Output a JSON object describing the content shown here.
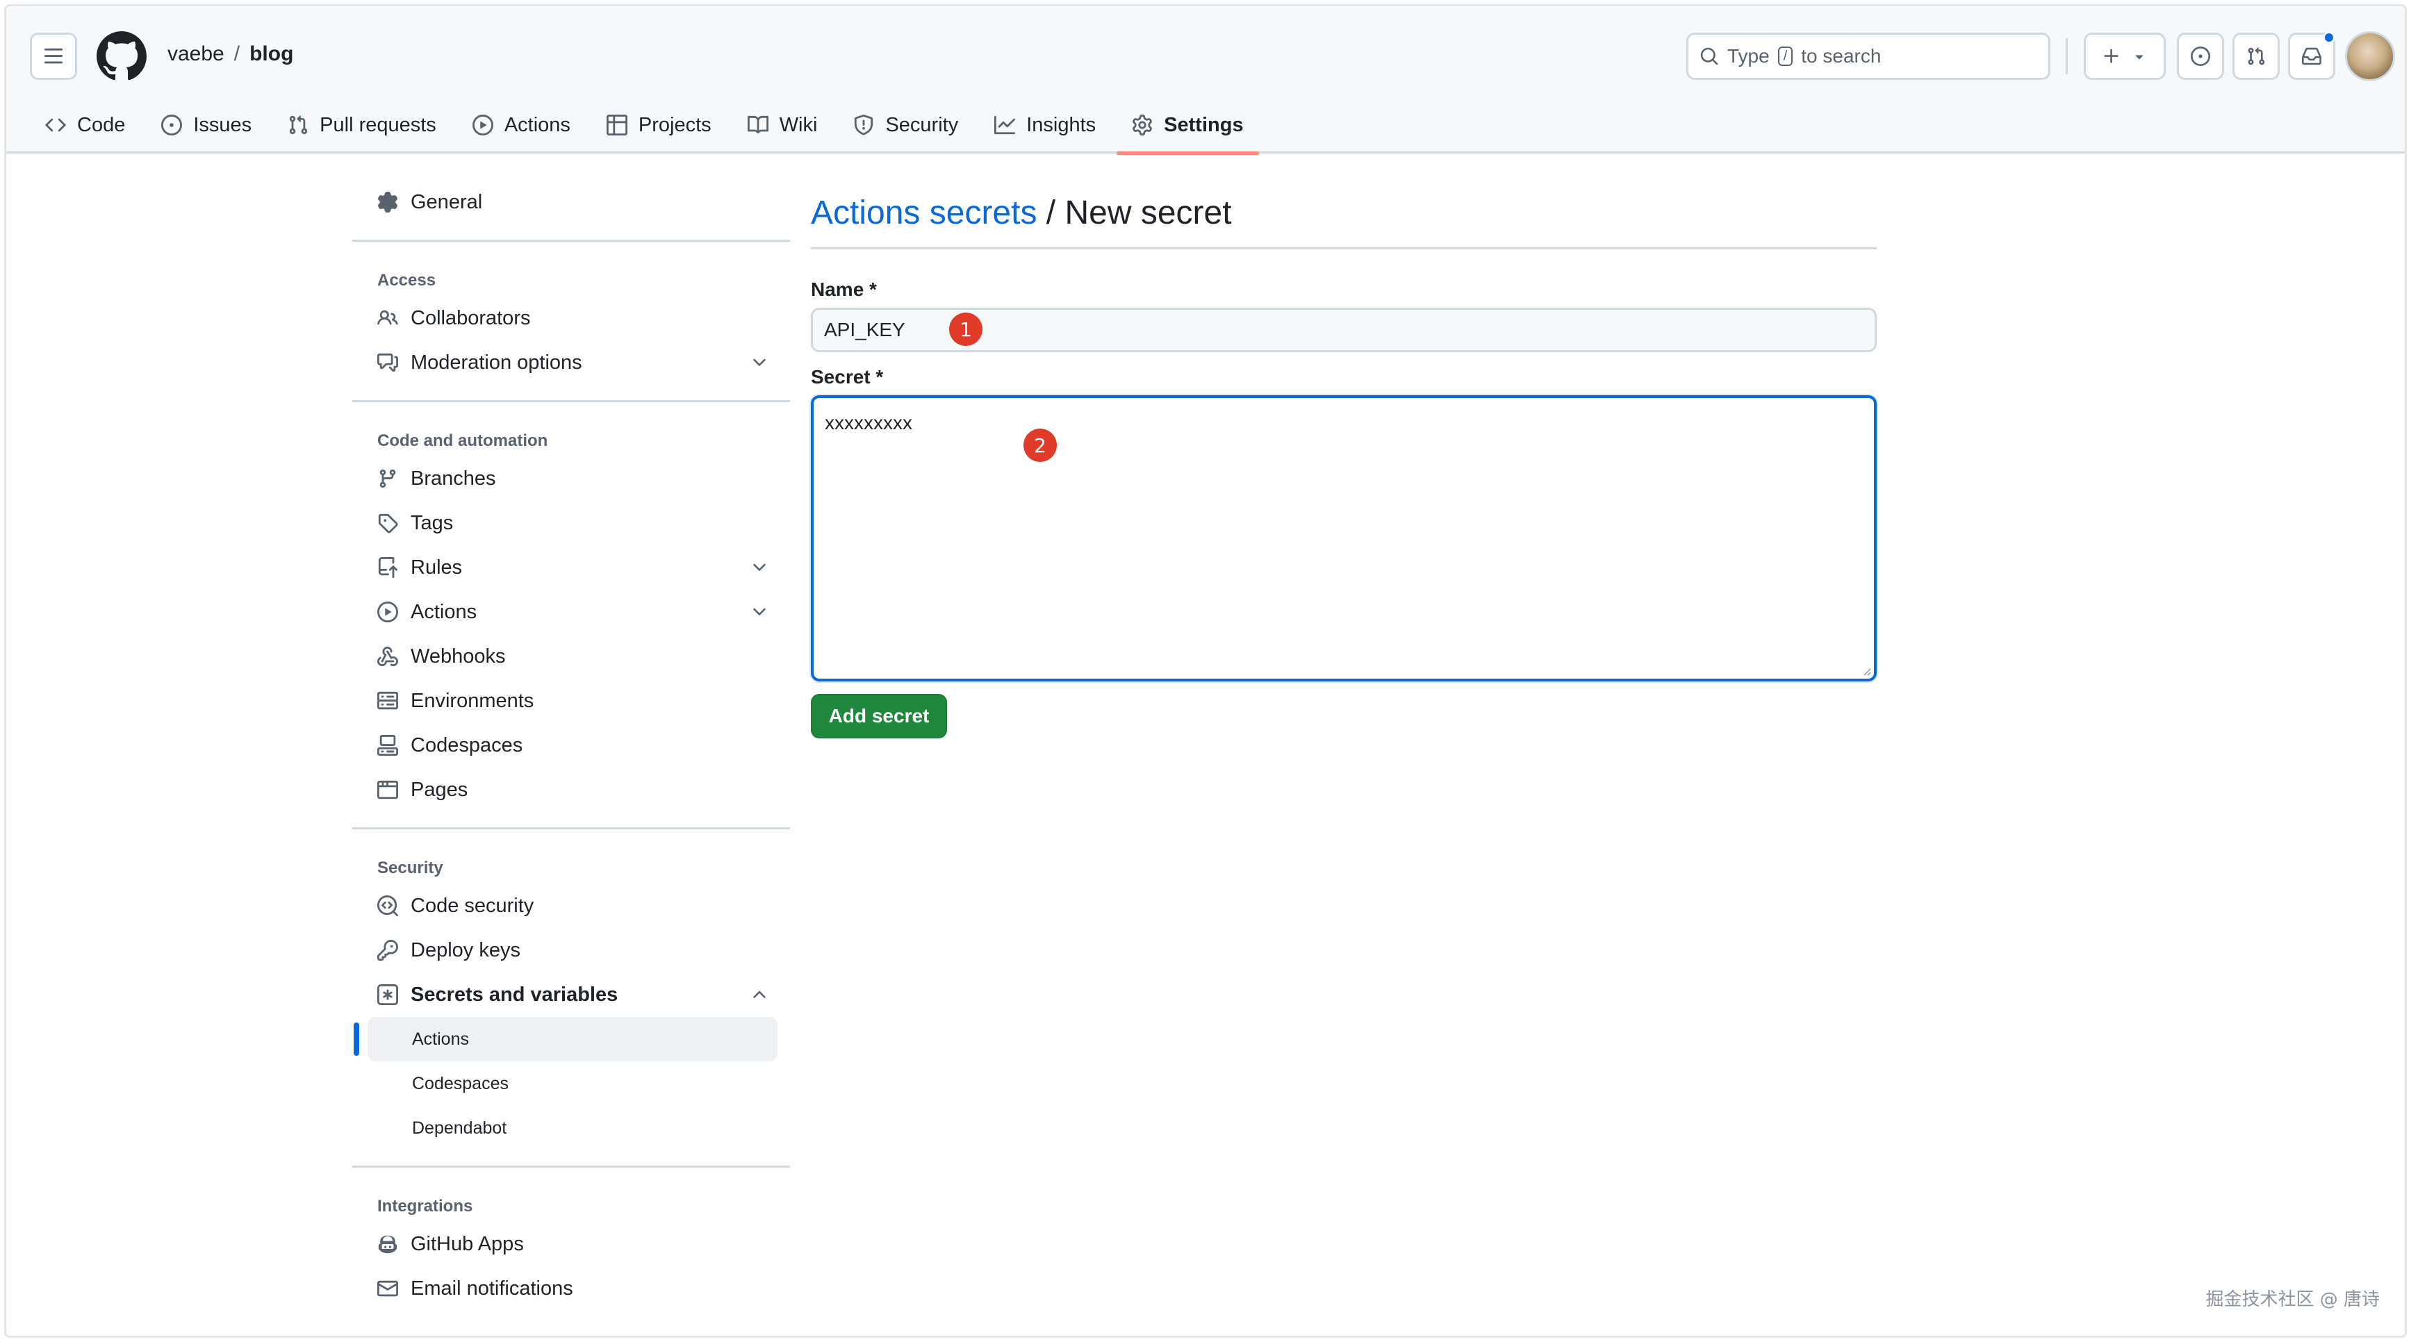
{
  "header": {
    "owner": "vaebe",
    "separator": "/",
    "repo": "blog",
    "search": {
      "prefix": "Type",
      "key": "/",
      "suffix": "to search"
    }
  },
  "tabs": [
    {
      "label": "Code",
      "icon": "code-icon"
    },
    {
      "label": "Issues",
      "icon": "issue-icon"
    },
    {
      "label": "Pull requests",
      "icon": "pull-request-icon"
    },
    {
      "label": "Actions",
      "icon": "play-icon"
    },
    {
      "label": "Projects",
      "icon": "table-icon"
    },
    {
      "label": "Wiki",
      "icon": "book-icon"
    },
    {
      "label": "Security",
      "icon": "shield-icon"
    },
    {
      "label": "Insights",
      "icon": "graph-icon"
    },
    {
      "label": "Settings",
      "icon": "gear-icon",
      "active": true
    }
  ],
  "sidebar": {
    "general": "General",
    "access_heading": "Access",
    "collaborators": "Collaborators",
    "moderation": "Moderation options",
    "code_heading": "Code and automation",
    "branches": "Branches",
    "tags": "Tags",
    "rules": "Rules",
    "actions": "Actions",
    "webhooks": "Webhooks",
    "environments": "Environments",
    "codespaces": "Codespaces",
    "pages": "Pages",
    "security_heading": "Security",
    "code_security": "Code security",
    "deploy_keys": "Deploy keys",
    "secrets_vars": "Secrets and variables",
    "sub_actions": "Actions",
    "sub_codespaces": "Codespaces",
    "sub_dependabot": "Dependabot",
    "integrations_heading": "Integrations",
    "github_apps": "GitHub Apps",
    "email_notifications": "Email notifications"
  },
  "main": {
    "title_link": "Actions secrets",
    "title_rest": " / New secret",
    "name_label": "Name *",
    "name_value": "API_KEY",
    "secret_label": "Secret *",
    "secret_value": "xxxxxxxxx",
    "submit": "Add secret",
    "badge1": "1",
    "badge2": "2"
  },
  "watermark": "掘金技术社区 @ 唐诗",
  "colors": {
    "accent": "#0969da",
    "submit": "#1f883d",
    "tab_underline": "#fd8c73",
    "badge": "#e03a28"
  }
}
